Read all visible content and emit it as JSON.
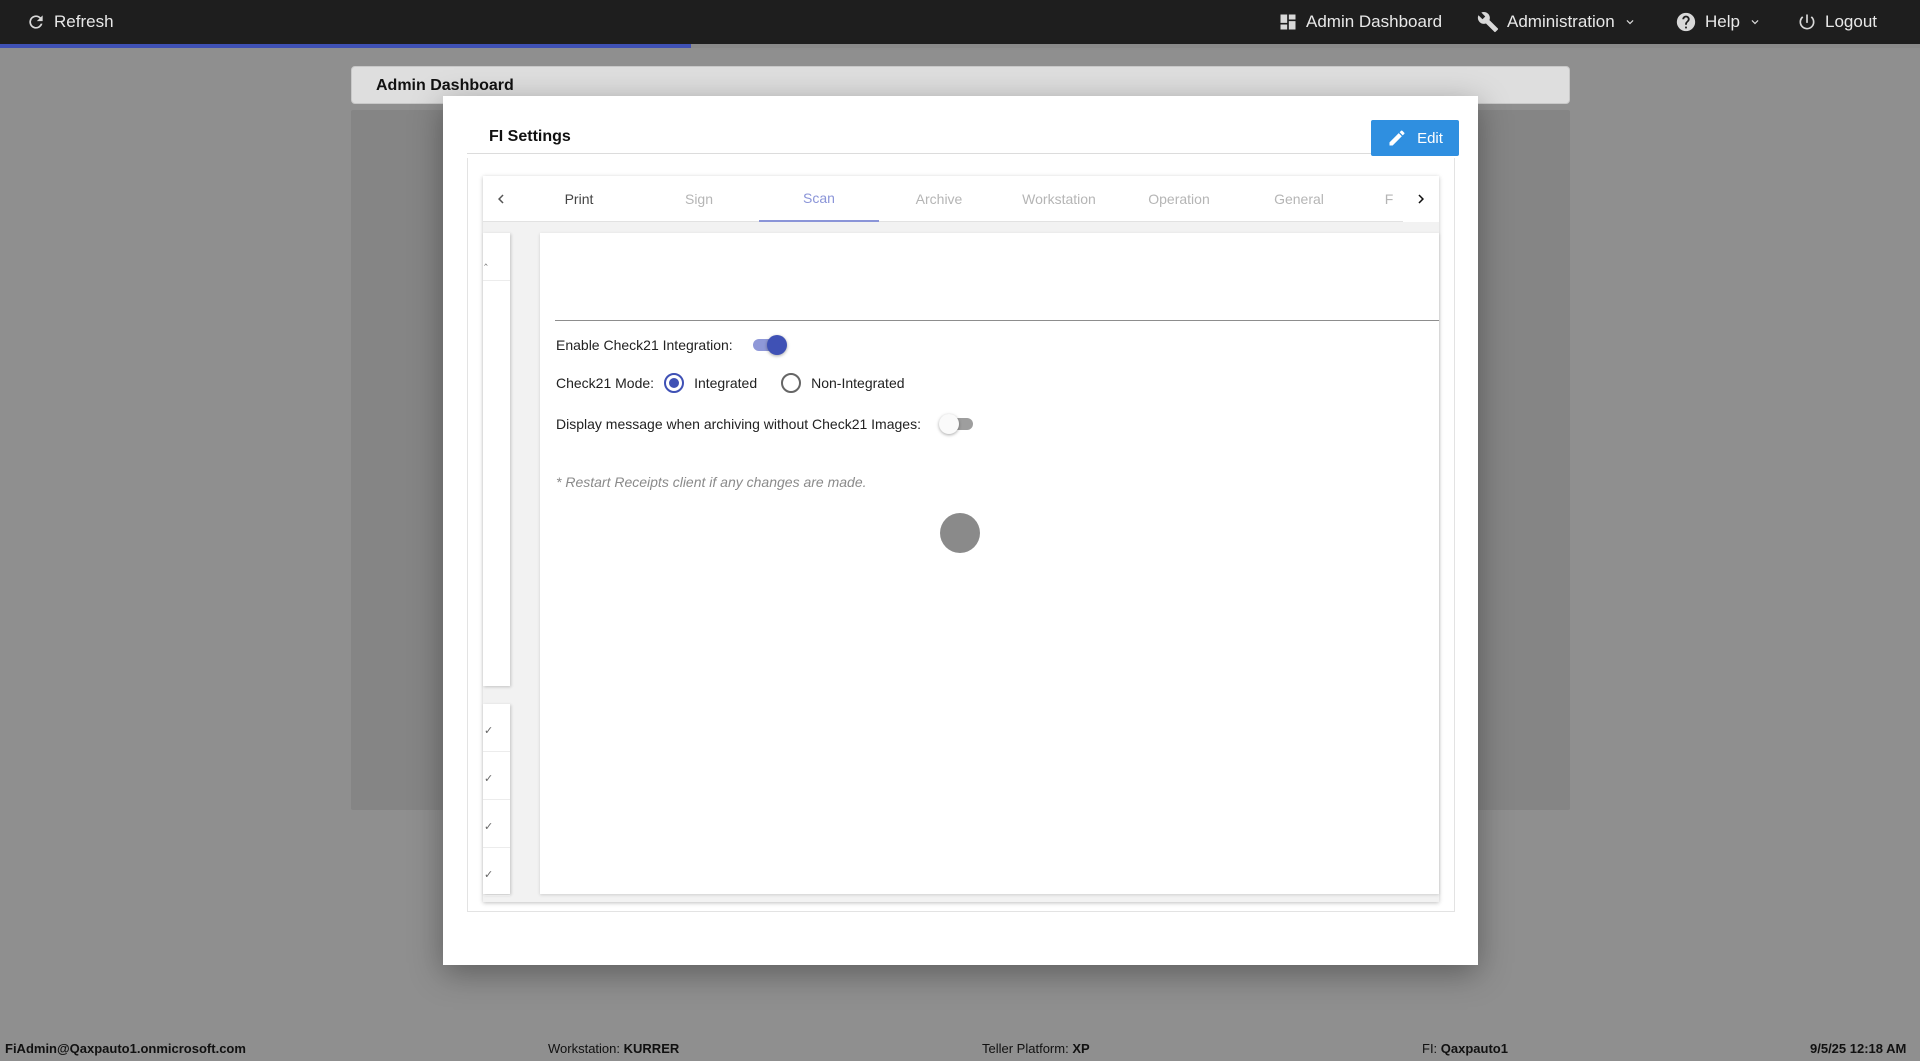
{
  "topbar": {
    "refresh_label": "Refresh",
    "admin_dashboard_label": "Admin Dashboard",
    "administration_label": "Administration",
    "help_label": "Help",
    "logout_label": "Logout"
  },
  "loading_progress_fraction": 0.36,
  "background_page": {
    "title": "Admin Dashboard"
  },
  "dialog": {
    "title": "FI Settings",
    "edit_label": "Edit",
    "tabs": [
      {
        "label": "Print",
        "active": false
      },
      {
        "label": "Sign",
        "active": false
      },
      {
        "label": "Scan",
        "active": true
      },
      {
        "label": "Archive",
        "active": false
      },
      {
        "label": "Workstation",
        "active": false
      },
      {
        "label": "Operation",
        "active": false
      },
      {
        "label": "General",
        "active": false
      },
      {
        "label": "F",
        "active": false
      }
    ],
    "scan": {
      "enable_check21_label": "Enable Check21 Integration:",
      "enable_check21_on": true,
      "check21_mode_label": "Check21 Mode:",
      "mode_options": [
        "Integrated",
        "Non-Integrated"
      ],
      "mode_selected": "Integrated",
      "display_message_label": "Display message when archiving without Check21 Images:",
      "display_message_on": false,
      "restart_note": "* Restart Receipts client if any changes are made."
    }
  },
  "statusbar": {
    "user": "FiAdmin@Qaxpauto1.onmicrosoft.com",
    "workstation_label": "Workstation:",
    "workstation_value": "KURRER",
    "teller_platform_label": "Teller Platform:",
    "teller_platform_value": "XP",
    "fi_label": "FI:",
    "fi_value": "Qaxpauto1",
    "datetime": "9/5/25 12:18 AM"
  },
  "colors": {
    "accent": "#3f51b5",
    "edit_button": "#2f8fe0",
    "topbar": "#1e1e1e"
  },
  "icons": {
    "refresh": "refresh-icon",
    "dashboard": "dashboard-icon",
    "administration": "wrench-icon",
    "help": "help-icon",
    "logout": "power-icon",
    "edit": "pencil-icon"
  }
}
